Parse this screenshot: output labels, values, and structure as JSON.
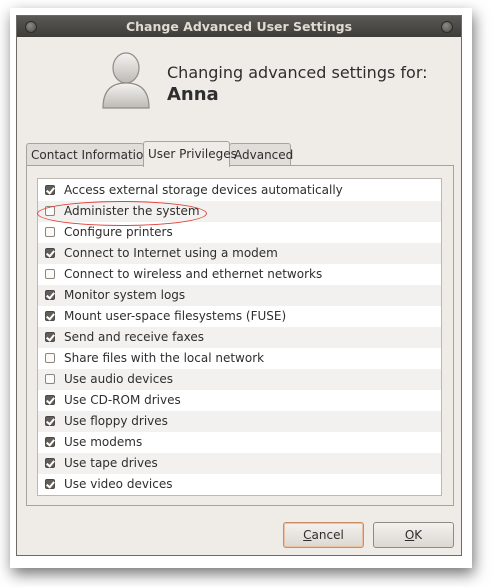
{
  "window": {
    "title": "Change Advanced User Settings"
  },
  "header": {
    "heading": "Changing advanced settings for:",
    "username": "Anna"
  },
  "tabs": [
    {
      "label": "Contact Information",
      "active": false
    },
    {
      "label": "User Privileges",
      "active": true
    },
    {
      "label": "Advanced",
      "active": false
    }
  ],
  "privileges": [
    {
      "label": "Access external storage devices automatically",
      "checked": true
    },
    {
      "label": "Administer the system",
      "checked": false
    },
    {
      "label": "Configure printers",
      "checked": false
    },
    {
      "label": "Connect to Internet using a modem",
      "checked": true
    },
    {
      "label": "Connect to wireless and ethernet networks",
      "checked": false
    },
    {
      "label": "Monitor system logs",
      "checked": true
    },
    {
      "label": "Mount user-space filesystems (FUSE)",
      "checked": true
    },
    {
      "label": "Send and receive faxes",
      "checked": true
    },
    {
      "label": "Share files with the local network",
      "checked": false
    },
    {
      "label": "Use audio devices",
      "checked": false
    },
    {
      "label": "Use CD-ROM drives",
      "checked": true
    },
    {
      "label": "Use floppy drives",
      "checked": true
    },
    {
      "label": "Use modems",
      "checked": true
    },
    {
      "label": "Use tape drives",
      "checked": true
    },
    {
      "label": "Use video devices",
      "checked": true
    }
  ],
  "buttons": {
    "cancel_mnemonic": "C",
    "cancel_rest": "ancel",
    "ok_mnemonic": "O",
    "ok_rest": "K"
  },
  "colors": {
    "titlebar": "#3d3c38",
    "window_bg": "#efebe7",
    "annotation": "#e0403a"
  }
}
